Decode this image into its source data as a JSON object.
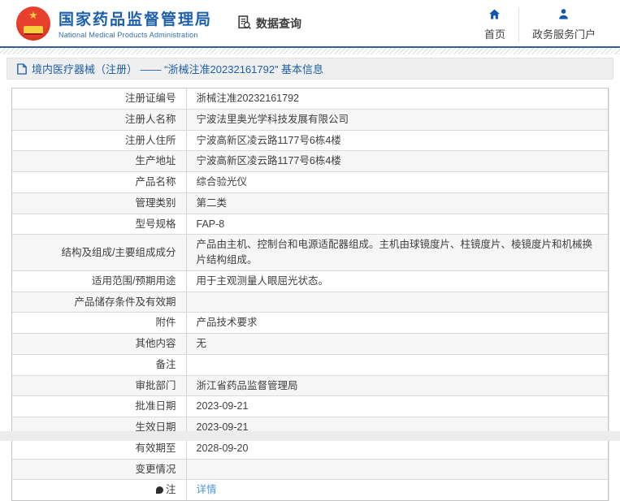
{
  "colors": {
    "brand_blue": "#1c60ab",
    "brand_sub_blue": "#2f6cb3",
    "breadcrumb_blue": "#1d5fa9",
    "link_blue": "#4c95da",
    "logo_red": "#d8281e",
    "icon_blue": "#1057a7",
    "text_dark": "#404040"
  },
  "header": {
    "brand": {
      "title": "国家药品监督管理局",
      "subtitle": "National Medical Products Administration"
    },
    "data_query_label": "数据查询",
    "nav": [
      {
        "label": "首页",
        "icon": "home-icon"
      },
      {
        "label": "政务服务门户",
        "icon": "person-icon"
      }
    ]
  },
  "breadcrumb": {
    "text": "境内医疗器械（注册） —— “浙械注准20232161792” 基本信息"
  },
  "table": {
    "rows": [
      {
        "label": "注册证编号",
        "value": "浙械注准20232161792"
      },
      {
        "label": "注册人名称",
        "value": "宁波法里奥光学科技发展有限公司"
      },
      {
        "label": "注册人住所",
        "value": "宁波高新区凌云路1177号6栋4楼"
      },
      {
        "label": "生产地址",
        "value": "宁波高新区凌云路1177号6栋4楼"
      },
      {
        "label": "产品名称",
        "value": "综合验光仪"
      },
      {
        "label": "管理类别",
        "value": "第二类"
      },
      {
        "label": "型号规格",
        "value": "FAP-8"
      },
      {
        "label": "结构及组成/主要组成成分",
        "value": "产品由主机、控制台和电源适配器组成。主机由球镜度片、柱镜度片、棱镜度片和机械换片结构组成。"
      },
      {
        "label": "适用范围/预期用途",
        "value": "用于主观测量人眼屈光状态。"
      },
      {
        "label": "产品储存条件及有效期",
        "value": ""
      },
      {
        "label": "附件",
        "value": "产品技术要求"
      },
      {
        "label": "其他内容",
        "value": "无"
      },
      {
        "label": "备注",
        "value": ""
      },
      {
        "label": "审批部门",
        "value": "浙江省药品监督管理局"
      },
      {
        "label": "批准日期",
        "value": "2023-09-21"
      },
      {
        "label": "生效日期",
        "value": "2023-09-21"
      },
      {
        "label": "有效期至",
        "value": "2028-09-20"
      },
      {
        "label": "变更情况",
        "value": ""
      },
      {
        "label": "注",
        "label_icon": "comment-icon",
        "value": "详情",
        "link": true
      }
    ]
  }
}
